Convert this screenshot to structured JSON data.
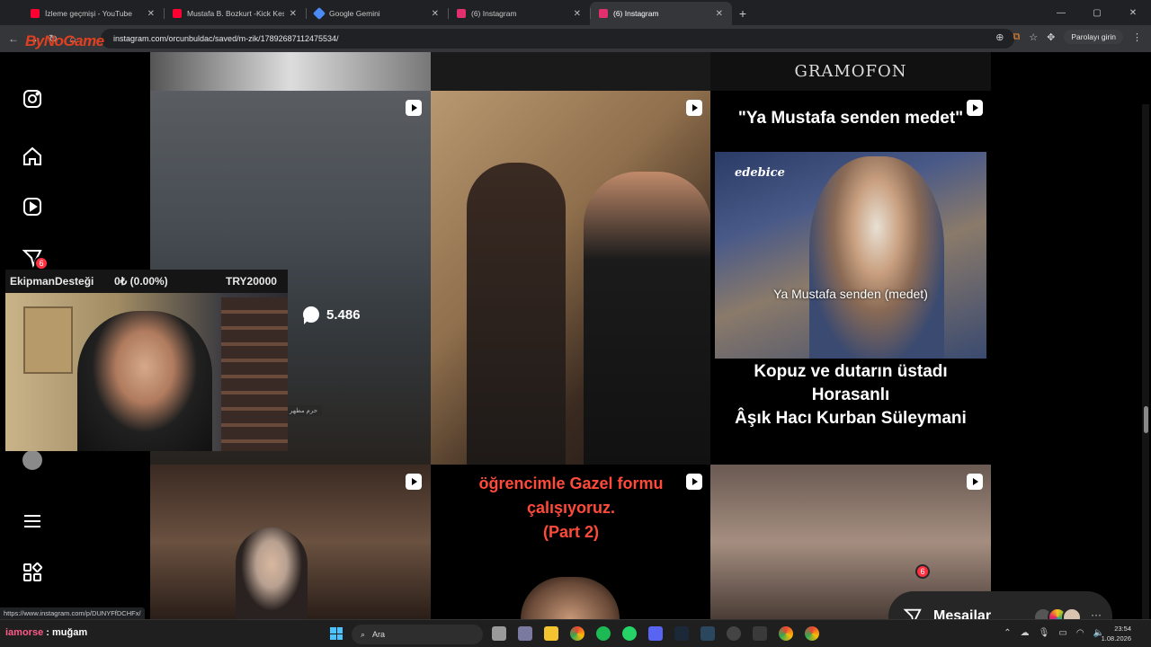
{
  "browser": {
    "tabs": [
      {
        "title": "İzleme geçmişi - YouTube",
        "favicon_color": "#ff0033"
      },
      {
        "title": "Mustafa B. Bozkurt -Kick Kesit",
        "favicon_color": "#ff0033"
      },
      {
        "title": "Google Gemini",
        "favicon_color": "#4b8bf5"
      },
      {
        "title": "(6) Instagram",
        "favicon_color": "#e1306c"
      },
      {
        "title": "(6) Instagram",
        "favicon_color": "#e1306c",
        "active": true
      }
    ],
    "url": "instagram.com/orcunbuldac/saved/m-zik/17892687112475534/",
    "password_button": "Parolayı girin",
    "stream_logo": "ByNoGame"
  },
  "instagram": {
    "sidebar_badge": "6",
    "grid": {
      "gramofon_label": "GRAMOFON",
      "mosque_post": {
        "comment_count": "5.486",
        "sign_text": "حرم مطهر"
      },
      "asik_post": {
        "quote": "\"Ya Mustafa senden medet\"",
        "channel_logo": "edebice",
        "photo_caption": "Ya Mustafa senden (medet)",
        "title_line1": "Kopuz ve dutarın üstadı",
        "title_line2": "Horasanlı",
        "title_line3": "Âşık Hacı Kurban Süleymani"
      },
      "gazel_post": {
        "line1": "öğrencimle Gazel formu",
        "line2": "çalışıyoruz.",
        "line3": "(Part 2)"
      }
    },
    "messages": {
      "label": "Mesajlar",
      "badge": "6"
    },
    "status_url": "https://www.instagram.com/p/DUNYFfDCHFx/"
  },
  "overlay": {
    "donation_label": "EkipmanDesteği",
    "donation_progress": "0₺ (0.00%)",
    "donation_goal": "TRY20000"
  },
  "taskbar": {
    "chat_user": "iamorse",
    "chat_message": "muğam",
    "search_placeholder": "Ara",
    "time": "23:54",
    "date": "1.08.2026"
  }
}
